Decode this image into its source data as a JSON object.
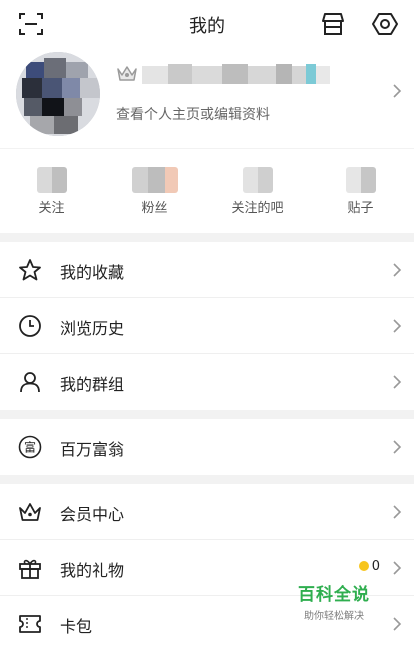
{
  "header": {
    "title": "我的",
    "scan_icon": "scan-icon",
    "store_icon": "store-icon",
    "settings_icon": "gear-icon"
  },
  "profile": {
    "edit_hint": "查看个人主页或编辑资料"
  },
  "stats": [
    {
      "label": "关注"
    },
    {
      "label": "粉丝"
    },
    {
      "label": "关注的吧"
    },
    {
      "label": "贴子"
    }
  ],
  "menu": {
    "favorites": {
      "label": "我的收藏",
      "icon": "star-icon"
    },
    "history": {
      "label": "浏览历史",
      "icon": "clock-icon"
    },
    "groups": {
      "label": "我的群组",
      "icon": "person-icon"
    },
    "millionaire": {
      "label": "百万富翁",
      "icon": "fu-icon",
      "icon_char": "富"
    },
    "vip": {
      "label": "会员中心",
      "icon": "crown-icon"
    },
    "gifts": {
      "label": "我的礼物",
      "icon": "gift-icon",
      "count": "0"
    },
    "wallet": {
      "label": "卡包",
      "icon": "ticket-icon"
    }
  },
  "watermark": {
    "title": "百科全说",
    "subtitle": "助你轻松解决"
  },
  "colors": {
    "accent_green": "#2fae4f",
    "coin_yellow": "#f7c51e",
    "divider": "#f2f2f2"
  }
}
